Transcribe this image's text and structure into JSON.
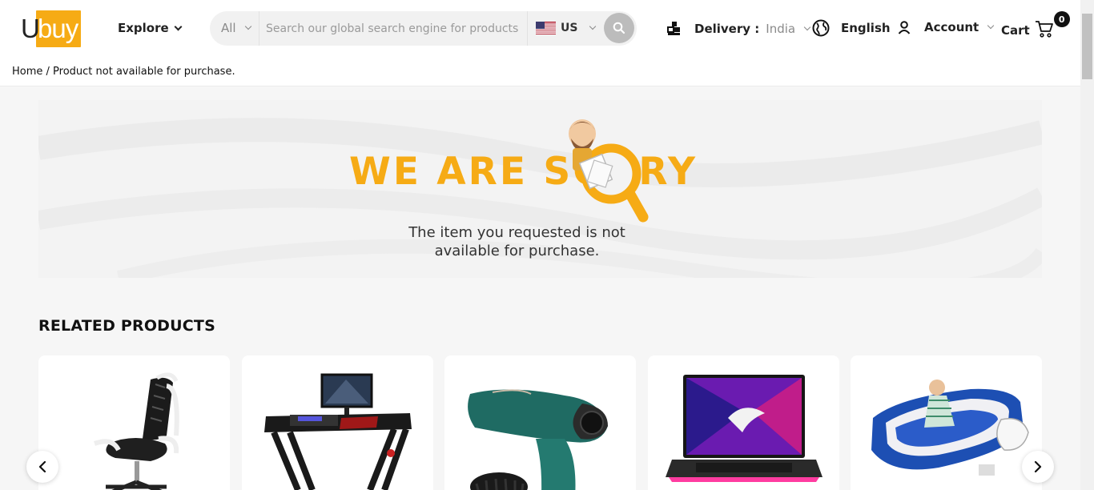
{
  "logo": {
    "part1": "U",
    "part2": "buy"
  },
  "header": {
    "explore_label": "Explore",
    "search": {
      "category": "All",
      "placeholder": "Search our global search engine for products",
      "country": "US"
    },
    "delivery": {
      "label": "Delivery :",
      "value": "India"
    },
    "language": "English",
    "account_label": "Account",
    "cart_label": "Cart",
    "cart_count": "0"
  },
  "breadcrumb": "Home / Product not available for purchase.",
  "sorry": {
    "heading": "WE ARE SORRY",
    "message": "The item you requested is not available for purchase."
  },
  "related": {
    "title": "RELATED PRODUCTS",
    "products": [
      {
        "icon": "office-chair"
      },
      {
        "icon": "gaming-desk"
      },
      {
        "icon": "hair-dryer"
      },
      {
        "icon": "gaming-laptop"
      },
      {
        "icon": "inflatable-toddler-bed"
      }
    ]
  },
  "colors": {
    "brand": "#f6ab15",
    "background": "#f6f6f6"
  }
}
